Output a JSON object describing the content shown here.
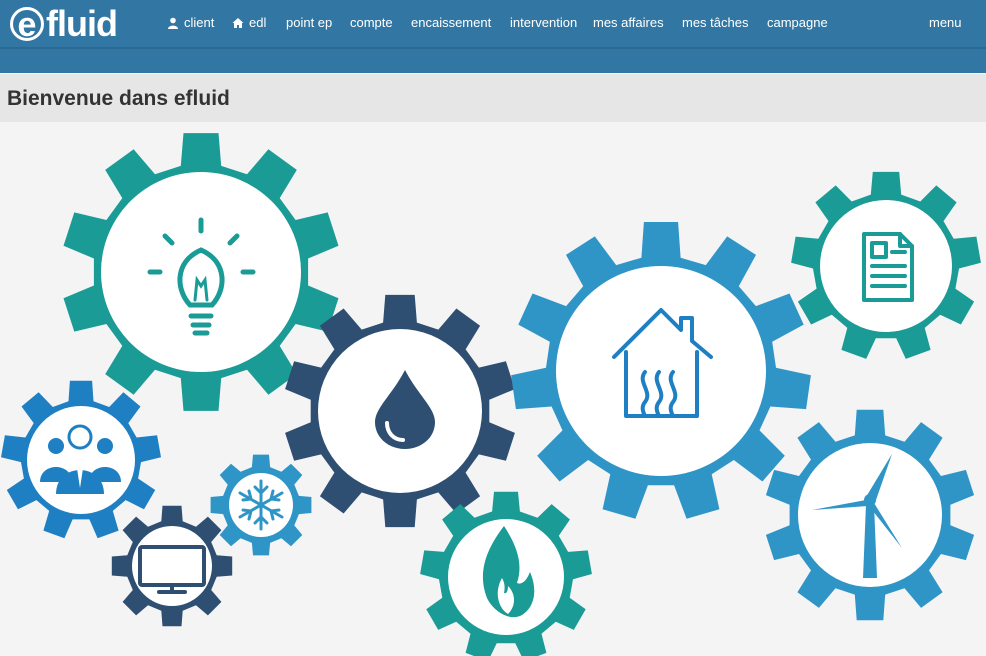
{
  "app": {
    "logo_letter": "e",
    "logo_word": "fluid"
  },
  "nav": {
    "items": [
      {
        "label": "client",
        "icon": "user-icon"
      },
      {
        "label": "edl",
        "icon": "home-icon"
      },
      {
        "label": "point ep",
        "icon": ""
      },
      {
        "label": "compte",
        "icon": ""
      },
      {
        "label": "encaissement",
        "icon": ""
      },
      {
        "label": "intervention",
        "icon": ""
      },
      {
        "label": "mes affaires",
        "icon": ""
      },
      {
        "label": "mes tâches",
        "icon": ""
      },
      {
        "label": "campagne",
        "icon": ""
      }
    ],
    "menu_label": "menu"
  },
  "page": {
    "title": "Bienvenue dans efluid"
  },
  "illustration": {
    "gears": [
      {
        "icon": "lightbulb-icon",
        "color": "#1a9b96"
      },
      {
        "icon": "water-drop-icon",
        "color": "#2e4e72"
      },
      {
        "icon": "heated-house-icon",
        "color": "#2f95c7"
      },
      {
        "icon": "document-icon",
        "color": "#1a9b96"
      },
      {
        "icon": "users-group-icon",
        "color": "#1f7fc3"
      },
      {
        "icon": "snowflake-icon",
        "color": "#2f95c7"
      },
      {
        "icon": "monitor-icon",
        "color": "#2e4e72"
      },
      {
        "icon": "flame-icon",
        "color": "#1a9b96"
      },
      {
        "icon": "wind-turbine-icon",
        "color": "#2f95c7"
      }
    ]
  },
  "colors": {
    "navbar": "#3277a3",
    "header_band": "#e6e6e6",
    "background": "#f4f4f4"
  }
}
